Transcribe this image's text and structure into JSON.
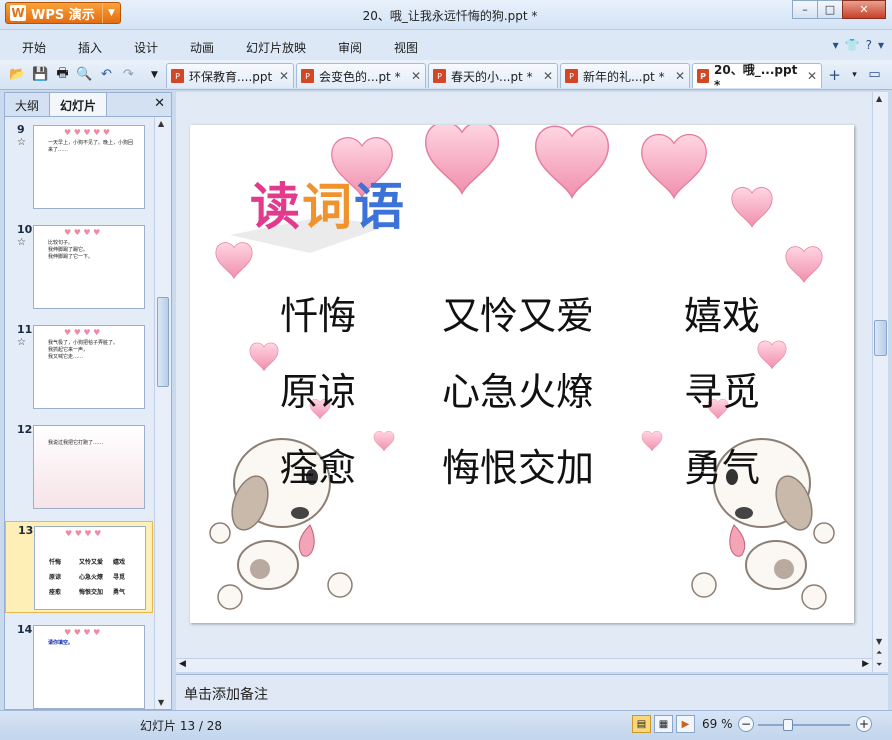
{
  "app": {
    "name": "WPS 演示",
    "document_title": "20、哦_让我永远忏悔的狗.ppt *"
  },
  "window_buttons": {
    "minimize": "–",
    "maximize": "□",
    "close": "✕"
  },
  "menu": {
    "items": [
      "开始",
      "插入",
      "设计",
      "动画",
      "幻灯片放映",
      "审阅",
      "视图"
    ],
    "right_icons": [
      "chevron-down-icon",
      "shirt-icon",
      "help-icon",
      "chevron-down-icon"
    ]
  },
  "doc_tabs": [
    {
      "label": "环保教育....ppt",
      "active": false
    },
    {
      "label": "会变色的...pt *",
      "active": false
    },
    {
      "label": "春天的小...pt *",
      "active": false
    },
    {
      "label": "新年的礼...pt *",
      "active": false
    },
    {
      "label": "20、哦_...ppt *",
      "active": true
    }
  ],
  "left_panel": {
    "tabs": [
      "大纲",
      "幻灯片"
    ],
    "active_tab": "幻灯片",
    "close": "✕",
    "thumbs": [
      {
        "num": "9",
        "star": "☆",
        "lines": [
          "一天早上，小狗不见了。晚上，小狗回来了……"
        ]
      },
      {
        "num": "10",
        "star": "☆",
        "lines": [
          "比较句子。",
          "我伸脚踢了踢它。",
          "我伸脚踢了它一下。"
        ]
      },
      {
        "num": "11",
        "star": "☆",
        "lines": [
          "我气极了，小狗把毯子弄脏了。",
          "我抓起它来一声，",
          "我又喊它走……"
        ]
      },
      {
        "num": "12",
        "star": "",
        "lines": [
          "我说过我把它打跑了……"
        ]
      },
      {
        "num": "13",
        "star": "",
        "selected": true,
        "grid": [
          "忏悔",
          "又怜又爱",
          "嬉戏",
          "原谅",
          "心急火燎",
          "寻觅",
          "痊愈",
          "悔恨交加",
          "勇气"
        ]
      },
      {
        "num": "14",
        "star": "",
        "lines": [
          "请你填空。"
        ]
      }
    ]
  },
  "slide": {
    "title_chars": [
      "读",
      "词",
      "语"
    ],
    "title_colors": [
      "#e23b8e",
      "#f1932d",
      "#3b73d9"
    ],
    "words": [
      [
        "忏悔",
        "又怜又爱",
        "嬉戏"
      ],
      [
        "原谅",
        "心急火燎",
        "寻觅"
      ],
      [
        "痊愈",
        "悔恨交加",
        "勇气"
      ]
    ]
  },
  "notes": {
    "placeholder": "单击添加备注"
  },
  "status": {
    "slide_info": "幻灯片 13 / 28",
    "zoom": "69 %",
    "zoom_minus": "−",
    "zoom_plus": "+",
    "zoom_level": 0.69
  }
}
